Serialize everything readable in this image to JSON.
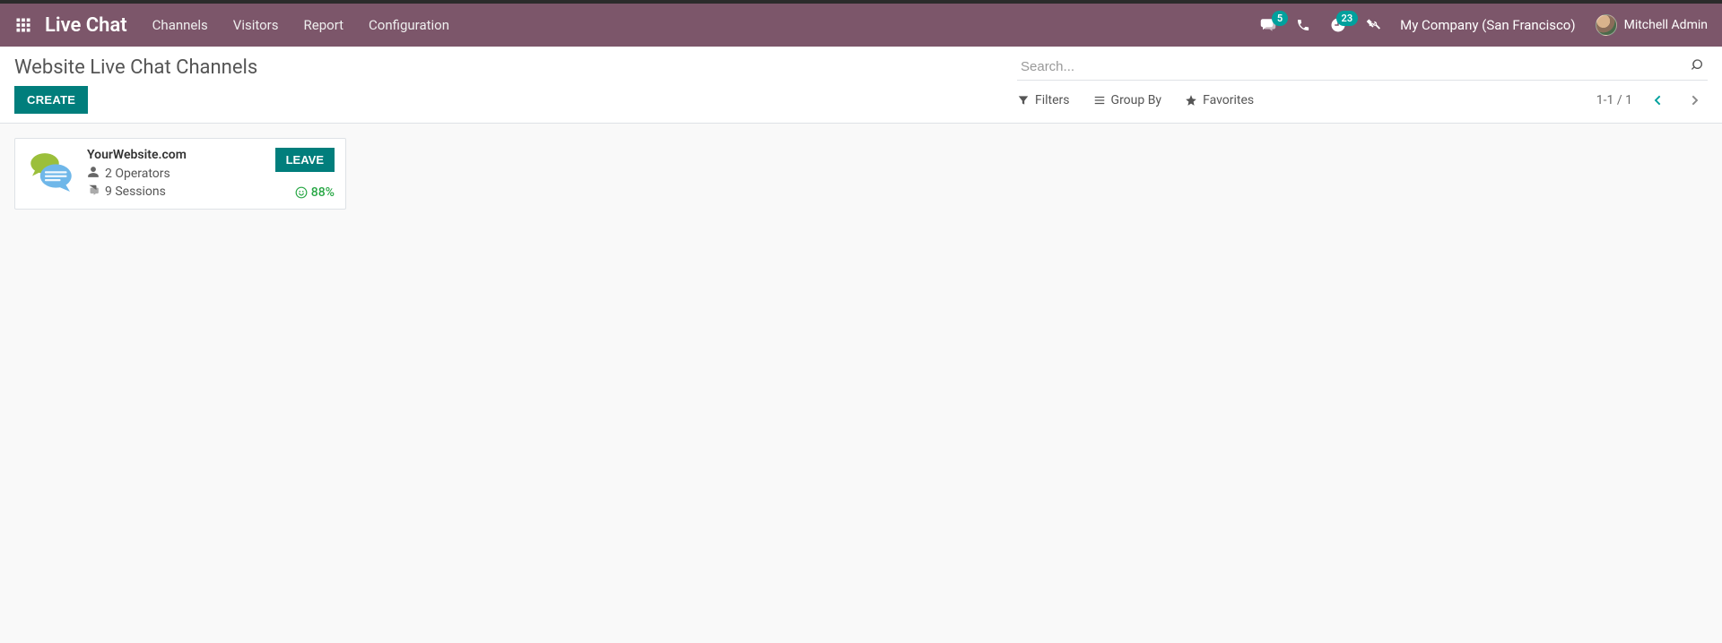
{
  "app": {
    "brand": "Live Chat",
    "menu": [
      {
        "label": "Channels"
      },
      {
        "label": "Visitors"
      },
      {
        "label": "Report"
      },
      {
        "label": "Configuration"
      }
    ]
  },
  "systray": {
    "messages_badge": "5",
    "activities_badge": "23",
    "company": "My Company (San Francisco)",
    "user_name": "Mitchell Admin"
  },
  "control_panel": {
    "breadcrumb": "Website Live Chat Channels",
    "search_placeholder": "Search...",
    "create_label": "CREATE",
    "filters_label": "Filters",
    "groupby_label": "Group By",
    "favorites_label": "Favorites",
    "pager": "1-1 / 1"
  },
  "channels": [
    {
      "name": "YourWebsite.com",
      "operators": "2 Operators",
      "sessions": "9 Sessions",
      "rating": "88%",
      "action_label": "LEAVE"
    }
  ]
}
